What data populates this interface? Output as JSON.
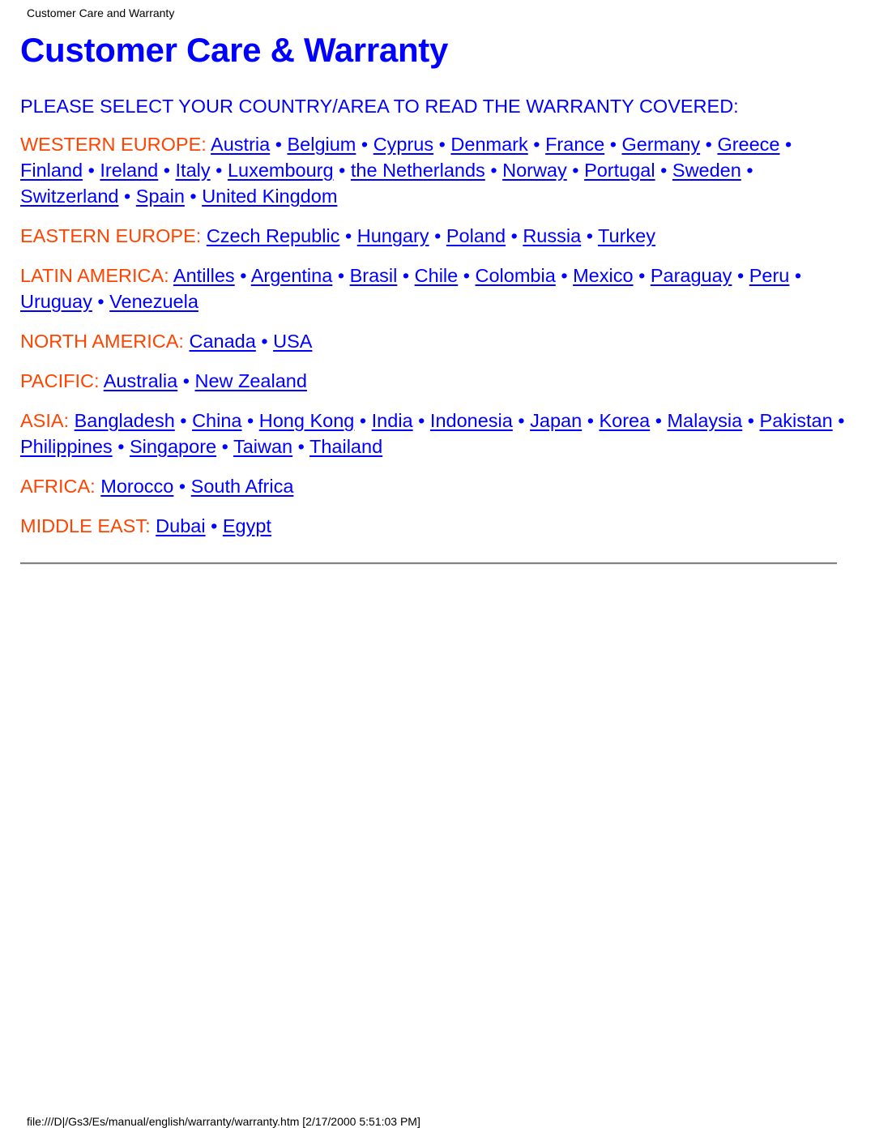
{
  "header": {
    "label": "Customer Care and Warranty"
  },
  "page": {
    "title": "Customer Care & Warranty",
    "intro": "PLEASE SELECT YOUR COUNTRY/AREA TO READ THE WARRANTY COVERED:"
  },
  "colors": {
    "title": "#0000ff",
    "region_label": "#ff4400",
    "link": "#0000ff"
  },
  "separator": "•",
  "regions": [
    {
      "label": "WESTERN EUROPE:",
      "countries": [
        "Austria",
        "Belgium",
        "Cyprus",
        "Denmark",
        "France",
        "Germany",
        "Greece",
        "Finland",
        "Ireland",
        "Italy",
        "Luxembourg",
        "the Netherlands",
        "Norway",
        "Portugal",
        "Sweden",
        "Switzerland",
        "Spain",
        "United Kingdom"
      ]
    },
    {
      "label": "EASTERN EUROPE:",
      "countries": [
        "Czech Republic",
        "Hungary",
        "Poland",
        "Russia",
        "Turkey"
      ]
    },
    {
      "label": "LATIN AMERICA:",
      "countries": [
        "Antilles",
        "Argentina",
        "Brasil",
        "Chile",
        "Colombia",
        "Mexico",
        "Paraguay",
        "Peru",
        "Uruguay",
        "Venezuela"
      ]
    },
    {
      "label": "NORTH AMERICA:",
      "countries": [
        "Canada",
        "USA"
      ]
    },
    {
      "label": "PACIFIC:",
      "countries": [
        "Australia",
        "New Zealand"
      ]
    },
    {
      "label": "ASIA:",
      "countries": [
        "Bangladesh",
        "China",
        "Hong Kong",
        "India",
        "Indonesia",
        "Japan",
        "Korea",
        "Malaysia",
        "Pakistan",
        "Philippines",
        "Singapore",
        "Taiwan",
        "Thailand"
      ]
    },
    {
      "label": "AFRICA:",
      "countries": [
        "Morocco",
        "South Africa"
      ]
    },
    {
      "label": "MIDDLE EAST:",
      "countries": [
        "Dubai",
        "Egypt"
      ]
    }
  ],
  "footer": {
    "path": "file:///D|/Gs3/Es/manual/english/warranty/warranty.htm [2/17/2000 5:51:03 PM]"
  }
}
